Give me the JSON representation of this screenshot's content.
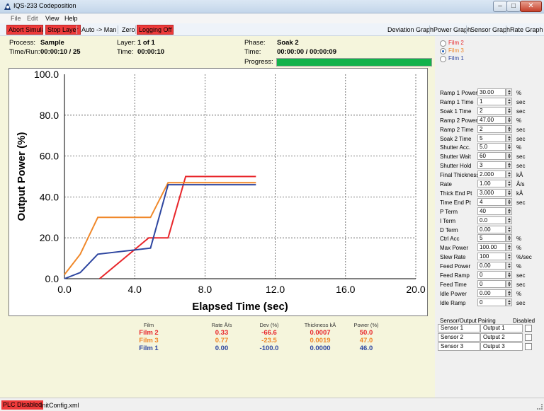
{
  "window": {
    "title": "IQS-233 Codeposition",
    "minimize": "–",
    "maximize": "□",
    "close": "✕"
  },
  "menu": {
    "file": "File",
    "edit": "Edit",
    "view": "View",
    "help": "Help"
  },
  "toolbar": {
    "abort_sim": "Abort Simulate",
    "stop_layer": "Stop Layer",
    "auto_man": "Auto -> Man",
    "zero": "Zero",
    "logging": "Logging Off",
    "dev_graph": "Deviation Graph",
    "power_graph": "Power Graph",
    "sensor_graph": "Sensor Graph",
    "rate_graph": "Rate Graph"
  },
  "status": {
    "process_label": "Process:",
    "process_value": "Sample",
    "timerun_label": "Time/Run:",
    "timerun_value": "00:00:10 / 25",
    "layer_label": "Layer:",
    "layer_value": "1 of 1",
    "time_label": "Time:",
    "time_value": "00:00:10",
    "phase_label": "Phase:",
    "phase_value": "Soak 2",
    "phase_time_label": "Time:",
    "phase_time_value": "00:00:00 / 00:00:09",
    "progress_label": "Progress:",
    "progress_fraction": 1.0
  },
  "chart_data": {
    "type": "line",
    "xlabel": "Elapsed Time (sec)",
    "ylabel": "Output Power (%)",
    "xlim": [
      0,
      20
    ],
    "ylim": [
      0,
      100
    ],
    "xticks": [
      "0.0",
      "4.0",
      "8.0",
      "12.0",
      "16.0",
      "20.0"
    ],
    "yticks": [
      "0.0",
      "20.0",
      "40.0",
      "60.0",
      "80.0",
      "100.0"
    ],
    "grid": true,
    "series": [
      {
        "name": "Film 2",
        "color": "#e8262b",
        "x": [
          2.0,
          4.8,
          5.9,
          6.9,
          10.9
        ],
        "y": [
          0,
          20,
          20,
          50,
          50
        ]
      },
      {
        "name": "Film 3",
        "color": "#f0882a",
        "x": [
          0.0,
          0.9,
          1.9,
          4.9,
          5.9,
          10.9
        ],
        "y": [
          2,
          12,
          30,
          30,
          47,
          47
        ]
      },
      {
        "name": "Film 1",
        "color": "#2e46a0",
        "x": [
          0.0,
          0.9,
          1.9,
          4.9,
          5.9,
          10.9
        ],
        "y": [
          0,
          3,
          12,
          15,
          46,
          46
        ]
      }
    ]
  },
  "film_select": {
    "items": [
      {
        "label": "Film 2",
        "color": "#e8262b",
        "selected": false
      },
      {
        "label": "Film 3",
        "color": "#f0882a",
        "selected": true
      },
      {
        "label": "Film 1",
        "color": "#2e46a0",
        "selected": false
      }
    ]
  },
  "summary": {
    "headers": {
      "film": "Film",
      "rate": "Rate Å/s",
      "dev": "Dev (%)",
      "thickness": "Thickness kÅ",
      "power": "Power (%)"
    },
    "rows": [
      {
        "film": "Film 2",
        "rate": "0.33",
        "dev": "-66.6",
        "thickness": "0.0007",
        "power": "50.0",
        "color": "#e8262b"
      },
      {
        "film": "Film 3",
        "rate": "0.77",
        "dev": "-23.5",
        "thickness": "0.0019",
        "power": "47.0",
        "color": "#f0882a"
      },
      {
        "film": "Film 1",
        "rate": "0.00",
        "dev": "-100.0",
        "thickness": "0.0000",
        "power": "46.0",
        "color": "#2e46a0"
      }
    ]
  },
  "params": [
    {
      "label": "Ramp 1 Power",
      "value": "30.00",
      "unit": "%"
    },
    {
      "label": "Ramp 1 Time",
      "value": "1",
      "unit": "sec"
    },
    {
      "label": "Soak 1 Time",
      "value": "2",
      "unit": "sec"
    },
    {
      "label": "Ramp 2 Power",
      "value": "47.00",
      "unit": "%"
    },
    {
      "label": "Ramp 2 Time",
      "value": "2",
      "unit": "sec"
    },
    {
      "label": "Soak 2 Time",
      "value": "5",
      "unit": "sec"
    },
    {
      "label": "Shutter Acc.",
      "value": "5.0",
      "unit": "%"
    },
    {
      "label": "Shutter Wait",
      "value": "60",
      "unit": "sec"
    },
    {
      "label": "Shutter Hold",
      "value": "3",
      "unit": "sec"
    },
    {
      "label": "Final Thickness",
      "value": "2.000",
      "unit": "kÅ"
    },
    {
      "label": "Rate",
      "value": "1.00",
      "unit": "Å/s"
    },
    {
      "label": "Thick End Pt",
      "value": "3.000",
      "unit": "kÅ"
    },
    {
      "label": "Time End Pt",
      "value": "4",
      "unit": "sec"
    },
    {
      "label": "P Term",
      "value": "40",
      "unit": ""
    },
    {
      "label": "I Term",
      "value": "0.0",
      "unit": ""
    },
    {
      "label": "D Term",
      "value": "0.00",
      "unit": ""
    },
    {
      "label": "Ctrl Acc",
      "value": "5",
      "unit": "%"
    },
    {
      "label": "Max Power",
      "value": "100.00",
      "unit": "%"
    },
    {
      "label": "Slew Rate",
      "value": "100",
      "unit": "%/sec"
    },
    {
      "label": "Feed Power",
      "value": "0.00",
      "unit": "%"
    },
    {
      "label": "Feed Ramp",
      "value": "0",
      "unit": "sec"
    },
    {
      "label": "Feed Time",
      "value": "0",
      "unit": "sec"
    },
    {
      "label": "Idle Power",
      "value": "0.00",
      "unit": "%"
    },
    {
      "label": "Idle Ramp",
      "value": "0",
      "unit": "sec"
    }
  ],
  "pairing": {
    "title": "Sensor/Output Pairing",
    "disabled": "Disabled",
    "rows": [
      {
        "sensor": "Sensor 1",
        "output": "Output 1"
      },
      {
        "sensor": "Sensor 2",
        "output": "Output 2"
      },
      {
        "sensor": "Sensor 3",
        "output": "Output 3"
      }
    ]
  },
  "statusbar": {
    "plc": "PLC Disabled",
    "config": "InitConfig.xml"
  }
}
